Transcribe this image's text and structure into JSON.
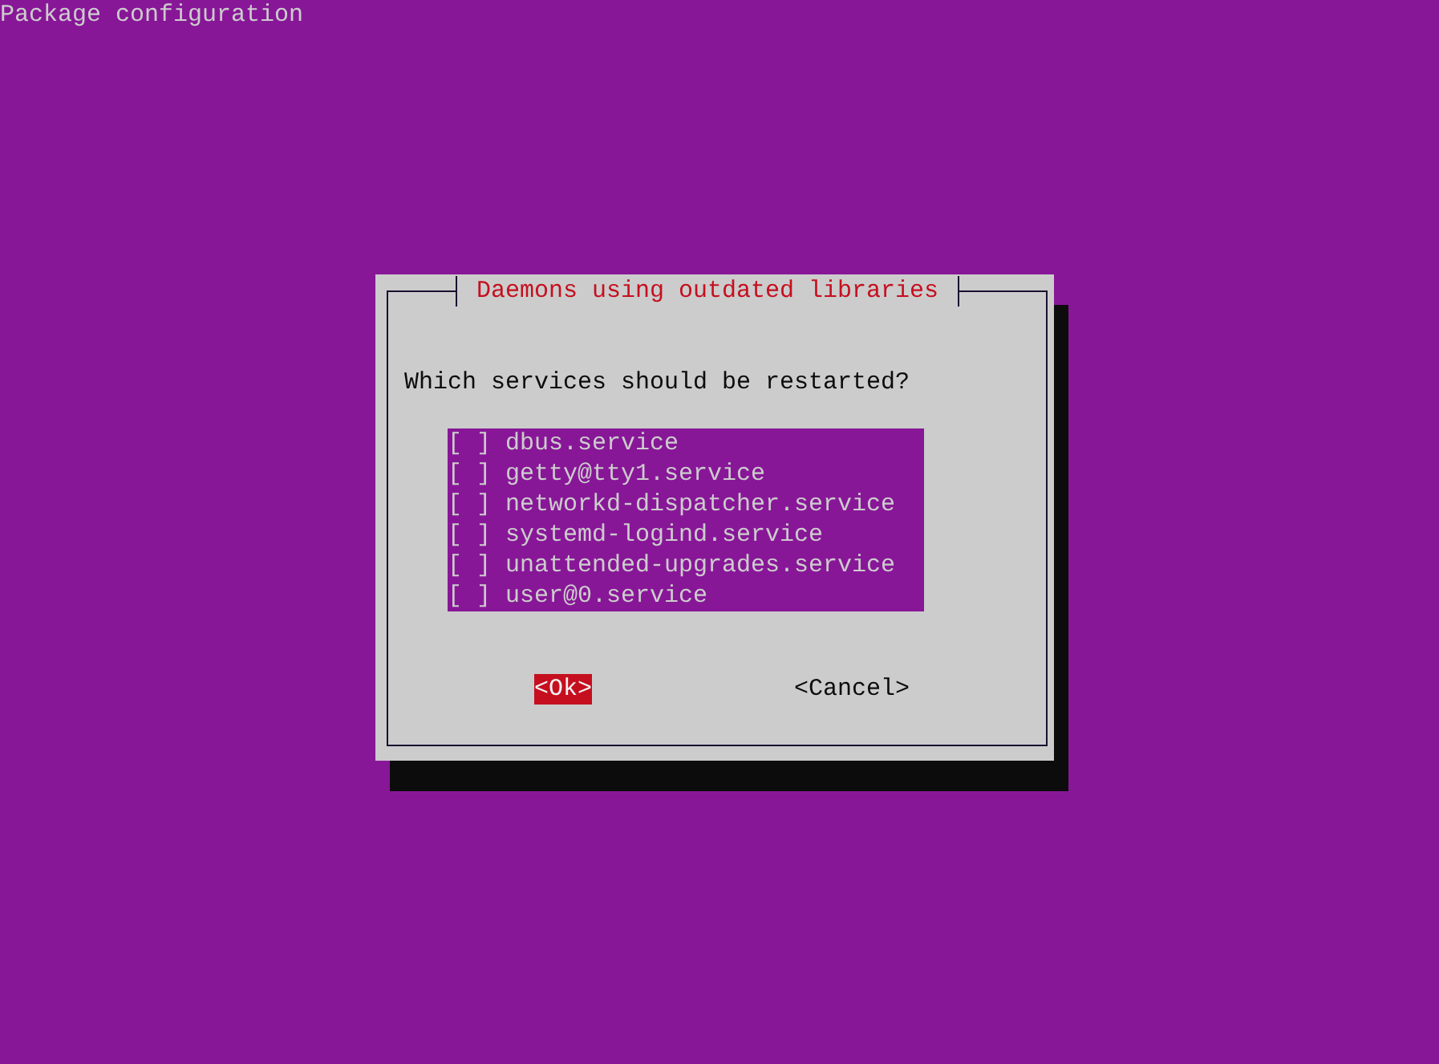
{
  "screen_title": "Package configuration",
  "dialog": {
    "title": "Daemons using outdated libraries",
    "prompt": "Which services should be restarted?",
    "items": [
      {
        "box": "[ ]",
        "checked": false,
        "label": "dbus.service"
      },
      {
        "box": "[ ]",
        "checked": false,
        "label": "getty@tty1.service"
      },
      {
        "box": "[ ]",
        "checked": false,
        "label": "networkd-dispatcher.service"
      },
      {
        "box": "[ ]",
        "checked": false,
        "label": "systemd-logind.service"
      },
      {
        "box": "[ ]",
        "checked": false,
        "label": "unattended-upgrades.service"
      },
      {
        "box": "[ ]",
        "checked": false,
        "label": "user@0.service"
      }
    ],
    "buttons": [
      {
        "label": "<Ok>",
        "selected": true
      },
      {
        "label": "<Cancel>",
        "selected": false
      }
    ]
  }
}
